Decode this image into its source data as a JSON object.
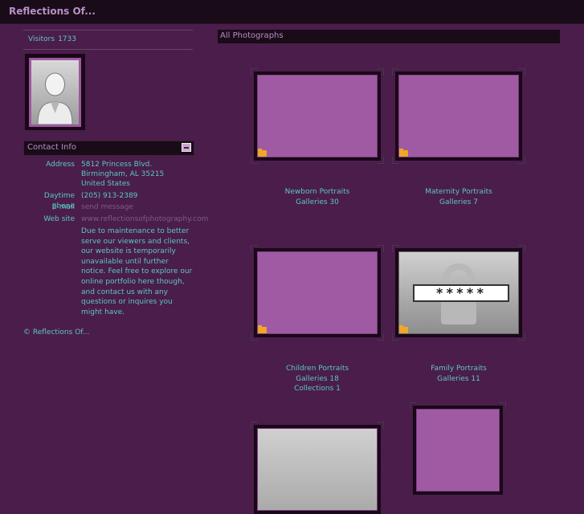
{
  "site": {
    "title": "Reflections Of..."
  },
  "visitors": {
    "label": "Visitors",
    "count": "1733"
  },
  "contact": {
    "header": "Contact Info",
    "address_label": "Address",
    "address_lines": [
      "5812 Princess Blvd.",
      "Birmingham, AL 35215",
      "United States"
    ],
    "phone_label": "Daytime phone",
    "phone": "(205) 913-2389",
    "email_label": "E-mail",
    "email": "send message",
    "website_label": "Web site",
    "website": "www.reflectionsofphotography.com",
    "notice": "Due to maintenance to better serve our viewers and clients, our website is temporarily unavailable until further notice. Feel free to explore our online portfolio here though, and contact us with any questions or inquires you might have."
  },
  "footer": {
    "copyright": "© Reflections Of..."
  },
  "main": {
    "header": "All Photographs",
    "galleries": [
      {
        "title": "Newborn Portraits",
        "line1": "Galleries 30",
        "line2": ""
      },
      {
        "title": "Maternity Portraits",
        "line1": "Galleries 7",
        "line2": ""
      },
      {
        "title": "Children Portraits",
        "line1": "Galleries 18",
        "line2": "Collections 1"
      },
      {
        "title": "Family Portraits",
        "line1": "Galleries 11",
        "line2": "",
        "password_mask": "*****"
      }
    ]
  },
  "colors": {
    "background": "#4a1d4b",
    "bar": "#190b18",
    "accent_text": "#5ec7c0",
    "title_text": "#b98fc4",
    "thumb_fill": "#a05aa4",
    "folder": "#f1a629"
  }
}
